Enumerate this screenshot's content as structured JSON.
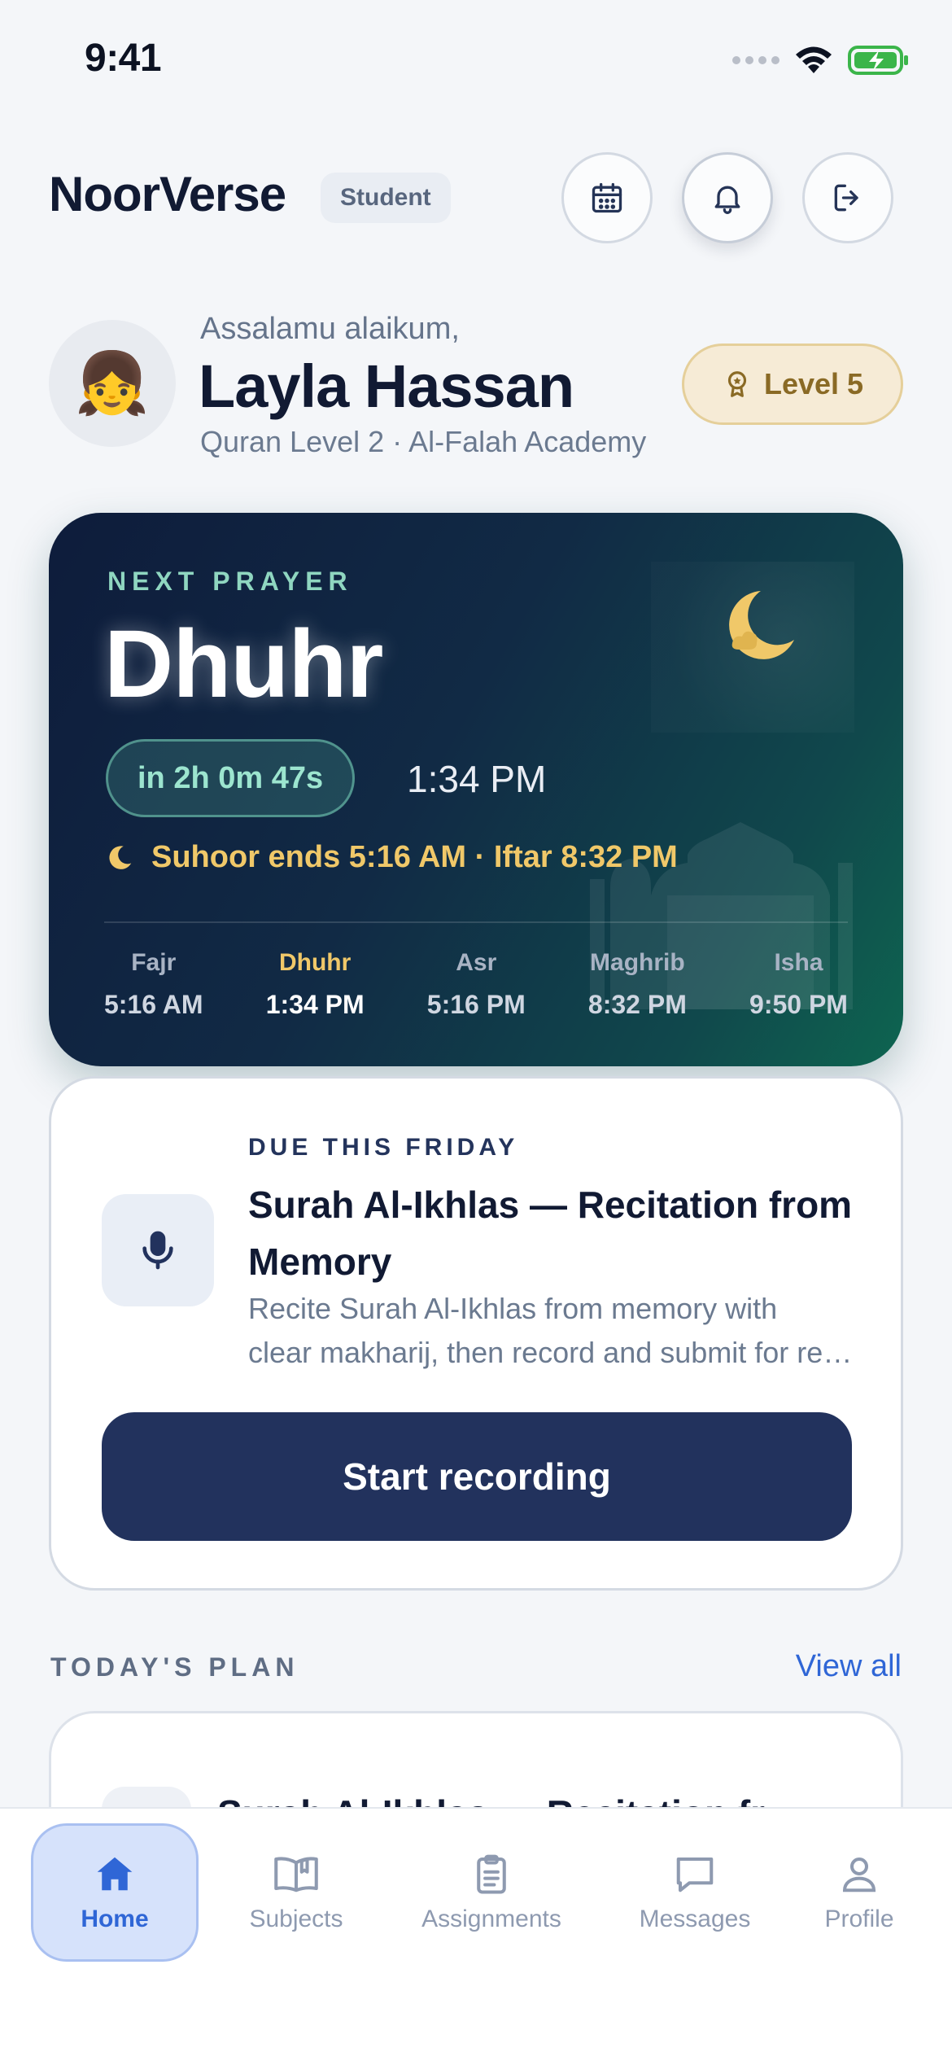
{
  "status_bar": {
    "time": "9:41"
  },
  "header": {
    "brand": "NoorVerse",
    "role_badge": "Student",
    "icons": [
      "calendar-icon",
      "bell-icon",
      "logout-icon"
    ]
  },
  "greeting": {
    "salutation": "Assalamu alaikum,",
    "name": "Layla Hassan",
    "subline": "Quran Level 2 · Al-Falah Academy",
    "avatar_emoji": "👧",
    "level_label": "Level 5"
  },
  "prayer": {
    "label": "NEXT PRAYER",
    "name": "Dhuhr",
    "countdown": "in 2h 0m 47s",
    "time": "1:34 PM",
    "suhoor_iftar": "Suhoor ends 5:16 AM · Iftar 8:32 PM",
    "colors": {
      "accent_teal": "#8fd6c0",
      "accent_gold": "#f0c869"
    },
    "times": [
      {
        "name": "Fajr",
        "time": "5:16 AM",
        "active": false
      },
      {
        "name": "Dhuhr",
        "time": "1:34 PM",
        "active": true
      },
      {
        "name": "Asr",
        "time": "5:16 PM",
        "active": false
      },
      {
        "name": "Maghrib",
        "time": "8:32 PM",
        "active": false
      },
      {
        "name": "Isha",
        "time": "9:50 PM",
        "active": false
      }
    ]
  },
  "assignment": {
    "due_label": "DUE THIS FRIDAY",
    "title": "Surah Al-Ikhlas — Recitation from Memory",
    "desc_line1": "Recite Surah Al-Ikhlas from memory with",
    "desc_line2": "clear makharij, then record and submit for review.",
    "button": "Start recording",
    "icon": "microphone-icon"
  },
  "plan": {
    "label": "TODAY'S PLAN",
    "view_all": "View all",
    "first_item_title": "Surah Al-Ikhlas — Recitation fr"
  },
  "tabs": [
    {
      "label": "Home",
      "icon": "home-icon",
      "active": true
    },
    {
      "label": "Subjects",
      "icon": "book-open-icon",
      "active": false
    },
    {
      "label": "Assignments",
      "icon": "clipboard-icon",
      "active": false
    },
    {
      "label": "Messages",
      "icon": "chat-icon",
      "active": false
    },
    {
      "label": "Profile",
      "icon": "user-icon",
      "active": false
    }
  ],
  "colors": {
    "brand_navy": "#22325d",
    "link_blue": "#2f66d6",
    "level_gold": "#8a6a25"
  }
}
